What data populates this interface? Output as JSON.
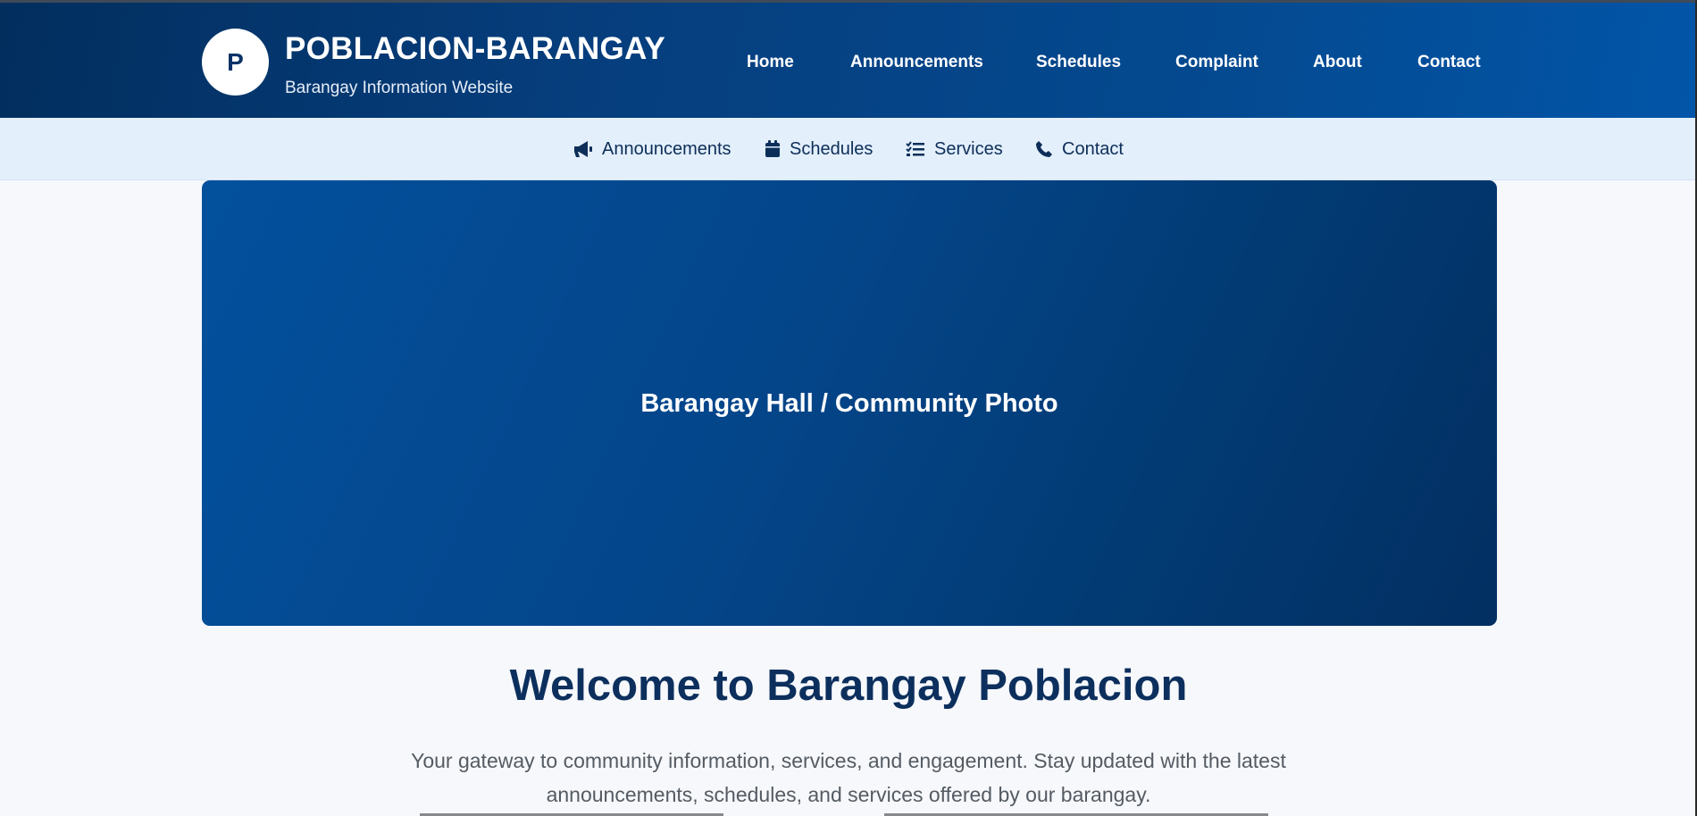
{
  "header": {
    "logo_letter": "P",
    "title": "POBLACION-BARANGAY",
    "subtitle": "Barangay Information Website"
  },
  "main_nav": [
    {
      "label": "Home"
    },
    {
      "label": "Announcements"
    },
    {
      "label": "Schedules"
    },
    {
      "label": "Complaint"
    },
    {
      "label": "About"
    },
    {
      "label": "Contact"
    }
  ],
  "sub_nav": [
    {
      "label": "Announcements",
      "icon": "megaphone-icon"
    },
    {
      "label": "Schedules",
      "icon": "calendar-icon"
    },
    {
      "label": "Services",
      "icon": "checklist-icon"
    },
    {
      "label": "Contact",
      "icon": "phone-icon"
    }
  ],
  "hero": {
    "caption": "Barangay Hall / Community Photo"
  },
  "welcome": {
    "title": "Welcome to Barangay Poblacion",
    "text": "Your gateway to community information, services, and engagement. Stay updated with the latest announcements, schedules, and services offered by our barangay."
  },
  "colors": {
    "header_dark": "#022e5e",
    "header_light": "#0255a8",
    "subnav_bg": "#e3effb",
    "accent_text": "#0c2f5d"
  }
}
